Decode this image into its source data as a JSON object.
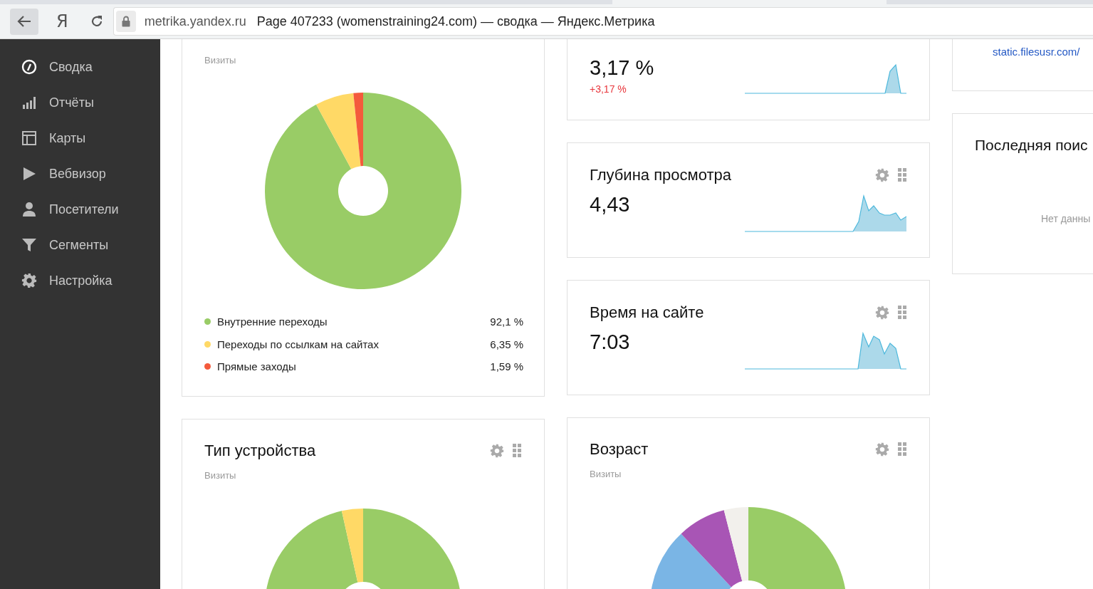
{
  "browser": {
    "logo": "Я",
    "address_domain": "metrika.yandex.ru",
    "address_title": "Page 407233 (womenstraining24.com) — сводка — Яндекс.Метрика"
  },
  "sidebar": {
    "items": [
      {
        "label": "Сводка"
      },
      {
        "label": "Отчёты"
      },
      {
        "label": "Карты"
      },
      {
        "label": "Вебвизор"
      },
      {
        "label": "Посетители"
      },
      {
        "label": "Сегменты"
      },
      {
        "label": "Настройка"
      }
    ]
  },
  "traffic_source": {
    "subtitle": "Визиты",
    "legend": [
      {
        "value": "92,1 %",
        "color": "#99cc66"
      },
      {
        "value": "6,35 %",
        "color": "#ffd966"
      },
      {
        "value": "1,59 %",
        "color": "#f45a3c"
      }
    ],
    "chart_data": {
      "type": "donut",
      "categories": [
        "Внутренние переходы",
        "Переходы по ссылкам на сайтах",
        "Прямые заходы"
      ],
      "values": [
        92.1,
        6.35,
        1.59
      ]
    }
  },
  "device_type": {
    "title": "Тип устройства",
    "subtitle": "Визиты"
  },
  "bounce_rate": {
    "value": "3,17 %",
    "change": "+3,17 %"
  },
  "depth": {
    "title": "Глубина просмотра",
    "value": "4,43"
  },
  "time_on_site": {
    "title": "Время на сайте",
    "value": "7:03"
  },
  "age": {
    "title": "Возраст",
    "subtitle": "Визиты"
  },
  "referrer": {
    "link": "static.filesusr.com/"
  },
  "last_search": {
    "title": "Последняя поис",
    "empty": "Нет данны"
  }
}
